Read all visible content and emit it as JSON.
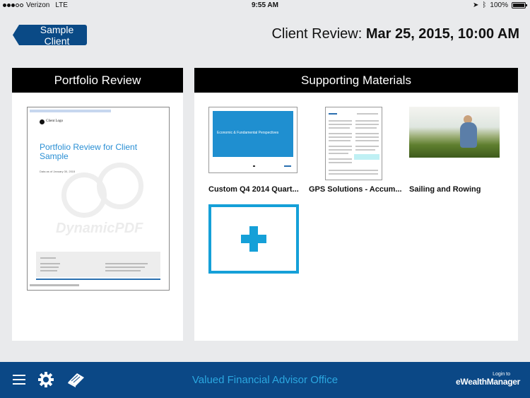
{
  "status_bar": {
    "carrier": "Verizon",
    "network": "LTE",
    "time": "9:55 AM",
    "battery": "100%",
    "icons": [
      "signal-dots-icon",
      "location-arrow-icon",
      "bluetooth-icon",
      "battery-icon"
    ]
  },
  "header": {
    "back_label": "Sample Client",
    "title_prefix": "Client Review:",
    "title_datetime": "Mar 25, 2015, 10:00 AM"
  },
  "portfolio": {
    "header": "Portfolio Review",
    "doc": {
      "logo_text": "Client Logo",
      "title": "Portfolio Review for Client Sample",
      "date_line": "Data as of January 30, 2015",
      "watermark": "DynamicPDF"
    }
  },
  "materials": {
    "header": "Supporting Materials",
    "items": [
      {
        "caption": "Custom Q4 2014 Quart...",
        "thumb_text": "Economic & Fundamental Perspectives"
      },
      {
        "caption": "GPS Solutions - Accum..."
      },
      {
        "caption": "Sailing and Rowing"
      }
    ],
    "add_icon": "plus-icon"
  },
  "footer": {
    "office": "Valued Financial Advisor Office",
    "login_line1": "Login to",
    "login_line2": "eWealthManager",
    "icons": [
      "menu-icon",
      "gear-icon",
      "book-icon"
    ]
  },
  "colors": {
    "navy": "#0b4886",
    "accent": "#15a0d8",
    "header_black": "#000000"
  }
}
